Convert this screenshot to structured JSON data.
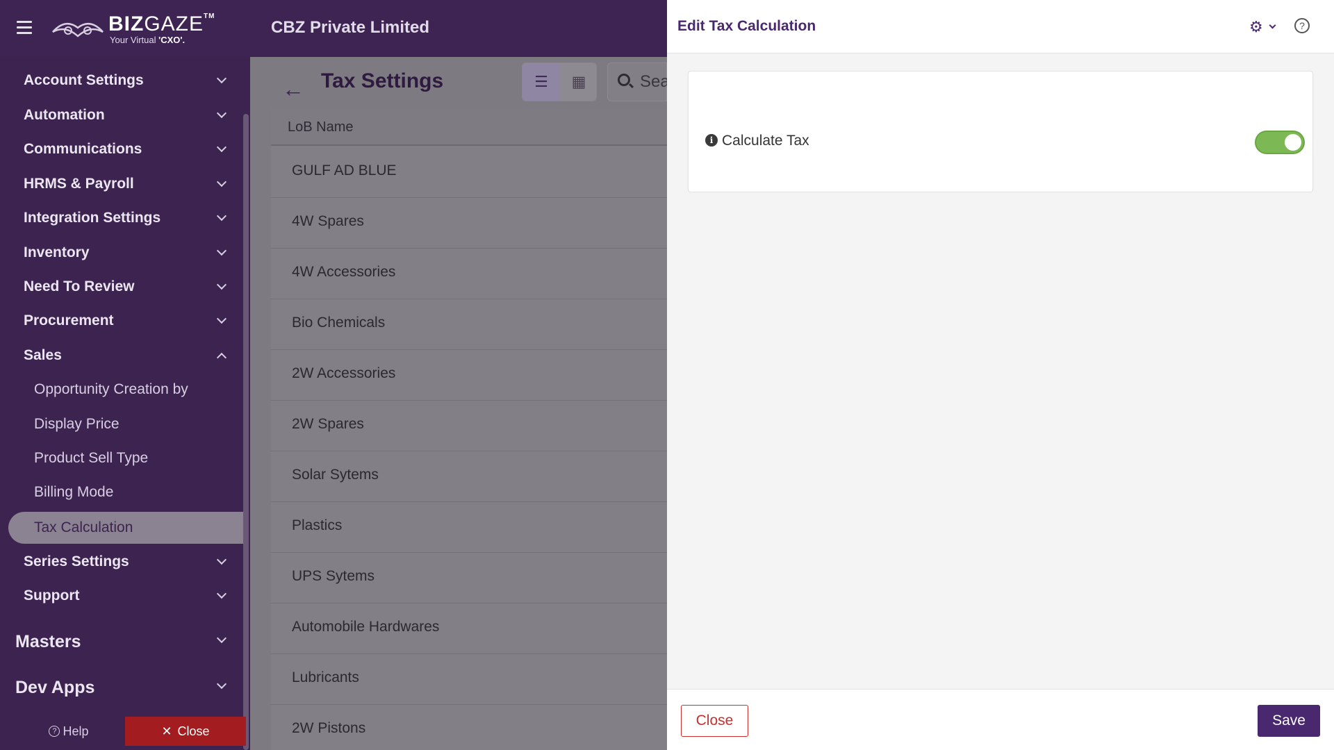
{
  "brand": {
    "logo_name_bold": "BIZ",
    "logo_name_light": "GAZE",
    "logo_tm": "TM",
    "logo_tagline_prefix": "Your Virtual ",
    "logo_tagline_bold": "'CXO'."
  },
  "company": "CBZ Private Limited",
  "sidebar": {
    "items": [
      {
        "label": "Account Settings"
      },
      {
        "label": "Automation"
      },
      {
        "label": "Communications"
      },
      {
        "label": "HRMS & Payroll"
      },
      {
        "label": "Integration Settings"
      },
      {
        "label": "Inventory"
      },
      {
        "label": "Need To Review"
      },
      {
        "label": "Procurement"
      },
      {
        "label": "Sales"
      }
    ],
    "sales_sub": [
      {
        "label": "Opportunity Creation by"
      },
      {
        "label": "Display Price"
      },
      {
        "label": "Product Sell Type"
      },
      {
        "label": "Billing Mode"
      },
      {
        "label": "Tax Calculation"
      }
    ],
    "after_items": [
      {
        "label": "Series Settings"
      },
      {
        "label": "Support"
      }
    ],
    "big_items": [
      {
        "label": "Masters"
      },
      {
        "label": "Dev Apps"
      }
    ],
    "footer": {
      "help": "Help",
      "close": "Close"
    }
  },
  "main": {
    "title": "Tax Settings",
    "search_placeholder": "Sea",
    "table": {
      "column": "LoB Name",
      "rows": [
        "GULF AD BLUE",
        "4W Spares",
        "4W Accessories",
        "Bio Chemicals",
        "2W Accessories",
        "2W Spares",
        "Solar Sytems",
        "Plastics",
        "UPS Sytems",
        "Automobile Hardwares",
        "Lubricants",
        "2W Pistons"
      ]
    }
  },
  "panel": {
    "title": "Edit Tax Calculation",
    "field_label": "Calculate Tax",
    "toggle_on": true,
    "close_label": "Close",
    "save_label": "Save"
  },
  "colors": {
    "brand": "#3d2350",
    "accent": "#4a2870",
    "toggle_on": "#7cb955",
    "danger": "#c9302c"
  }
}
